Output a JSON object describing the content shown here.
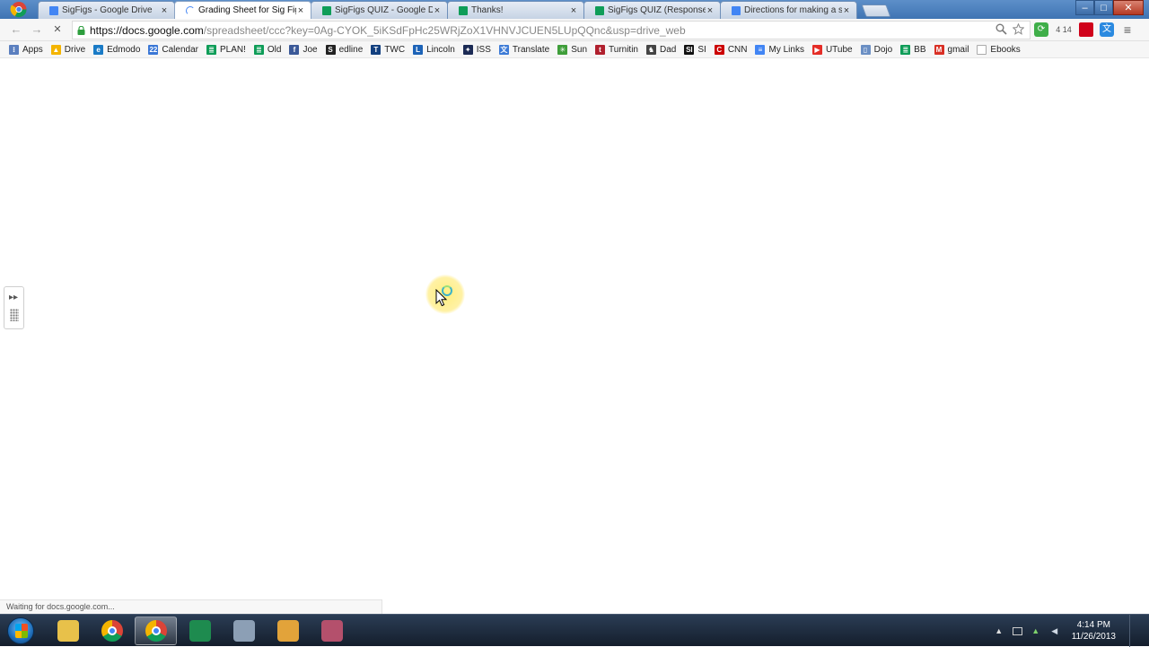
{
  "browser": {
    "tabs": [
      {
        "title": "SigFigs - Google Drive",
        "icon": "google-drive-icon",
        "color": "#4285f4",
        "active": false
      },
      {
        "title": "Grading Sheet for Sig Figs",
        "icon": "loading-spinner-icon",
        "color": "#4285f4",
        "active": true
      },
      {
        "title": "SigFigs QUIZ - Google Dri",
        "icon": "google-sheets-icon",
        "color": "#0f9d58",
        "active": false
      },
      {
        "title": "Thanks!",
        "icon": "google-sheets-icon",
        "color": "#0f9d58",
        "active": false
      },
      {
        "title": "SigFigs QUIZ (Responses)",
        "icon": "google-sheets-icon",
        "color": "#0f9d58",
        "active": false
      },
      {
        "title": "Directions for making a se",
        "icon": "google-docs-icon",
        "color": "#4285f4",
        "active": false
      }
    ],
    "tab_close_glyph": "×",
    "window": {
      "minimize": "–",
      "maximize": "□",
      "close": "✕"
    }
  },
  "toolbar": {
    "back": "←",
    "forward": "→",
    "stop": "✕",
    "url_host": "https://docs.google.com",
    "url_rest": "/spreadsheet/ccc?key=0Ag-CYOK_5iKSdFpHc25WRjZoX1VHNVJCUEN5LUpQQnc&usp=drive_web",
    "extension_badge": "4 14",
    "menu_glyph": "≡"
  },
  "bookmarks": [
    {
      "label": "Apps",
      "icon": "apps-grid-icon",
      "color": "#5b7fbf",
      "glyph": "⁝"
    },
    {
      "label": "Drive",
      "icon": "google-drive-icon",
      "color": "#f4b400",
      "glyph": "▲"
    },
    {
      "label": "Edmodo",
      "icon": "edmodo-icon",
      "color": "#1a7bc6",
      "glyph": "e"
    },
    {
      "label": "Calendar",
      "icon": "calendar-icon",
      "color": "#3a77d6",
      "glyph": "22"
    },
    {
      "label": "PLAN!",
      "icon": "google-sheets-icon",
      "color": "#0f9d58",
      "glyph": "≣"
    },
    {
      "label": "Old",
      "icon": "google-sheets-icon",
      "color": "#0f9d58",
      "glyph": "≣"
    },
    {
      "label": "Joe",
      "icon": "facebook-icon",
      "color": "#3b5998",
      "glyph": "f"
    },
    {
      "label": "edline",
      "icon": "edline-icon",
      "color": "#222222",
      "glyph": "S"
    },
    {
      "label": "TWC",
      "icon": "twc-icon",
      "color": "#13407f",
      "glyph": "T"
    },
    {
      "label": "Lincoln",
      "icon": "lincoln-icon",
      "color": "#1d63b7",
      "glyph": "L"
    },
    {
      "label": "ISS",
      "icon": "iss-icon",
      "color": "#1c2b55",
      "glyph": "✦"
    },
    {
      "label": "Translate",
      "icon": "translate-icon",
      "color": "#3d7bd6",
      "glyph": "文"
    },
    {
      "label": "Sun",
      "icon": "sun-icon",
      "color": "#3f9e3a",
      "glyph": "✳"
    },
    {
      "label": "Turnitin",
      "icon": "turnitin-icon",
      "color": "#b0202e",
      "glyph": "t"
    },
    {
      "label": "Dad",
      "icon": "dad-icon",
      "color": "#444444",
      "glyph": "♞"
    },
    {
      "label": "SI",
      "icon": "si-icon",
      "color": "#111111",
      "glyph": "SI"
    },
    {
      "label": "CNN",
      "icon": "cnn-icon",
      "color": "#cc0000",
      "glyph": "C"
    },
    {
      "label": "My Links",
      "icon": "google-docs-icon",
      "color": "#4285f4",
      "glyph": "≡"
    },
    {
      "label": "UTube",
      "icon": "youtube-icon",
      "color": "#e52d27",
      "glyph": "▶"
    },
    {
      "label": "Dojo",
      "icon": "dojo-icon",
      "color": "#6b8fc4",
      "glyph": "▯"
    },
    {
      "label": "BB",
      "icon": "google-sheets-icon",
      "color": "#0f9d58",
      "glyph": "≣"
    },
    {
      "label": "gmail",
      "icon": "gmail-icon",
      "color": "#d93025",
      "glyph": "M"
    },
    {
      "label": "Ebooks",
      "icon": "folder-icon",
      "color": "#dddddd",
      "glyph": ""
    }
  ],
  "status_text": "Waiting for docs.google.com...",
  "side_panel": {
    "arrows": "▸▸"
  },
  "taskbar": {
    "apps": [
      {
        "name": "file-explorer-icon",
        "color": "#e8c14a",
        "active": false
      },
      {
        "name": "chrome-icon",
        "color": "#db4437",
        "active": false
      },
      {
        "name": "chrome-icon",
        "color": "#4285f4",
        "active": true
      },
      {
        "name": "excel-icon",
        "color": "#1e8b4f",
        "active": false
      },
      {
        "name": "settings-wheel-icon",
        "color": "#8c9fb5",
        "active": false
      },
      {
        "name": "outlook-icon",
        "color": "#e2a33a",
        "active": false
      },
      {
        "name": "screen-recorder-icon",
        "color": "#b4506c",
        "active": false
      }
    ],
    "tray_expand": "▲",
    "time": "4:14 PM",
    "date": "11/26/2013"
  }
}
